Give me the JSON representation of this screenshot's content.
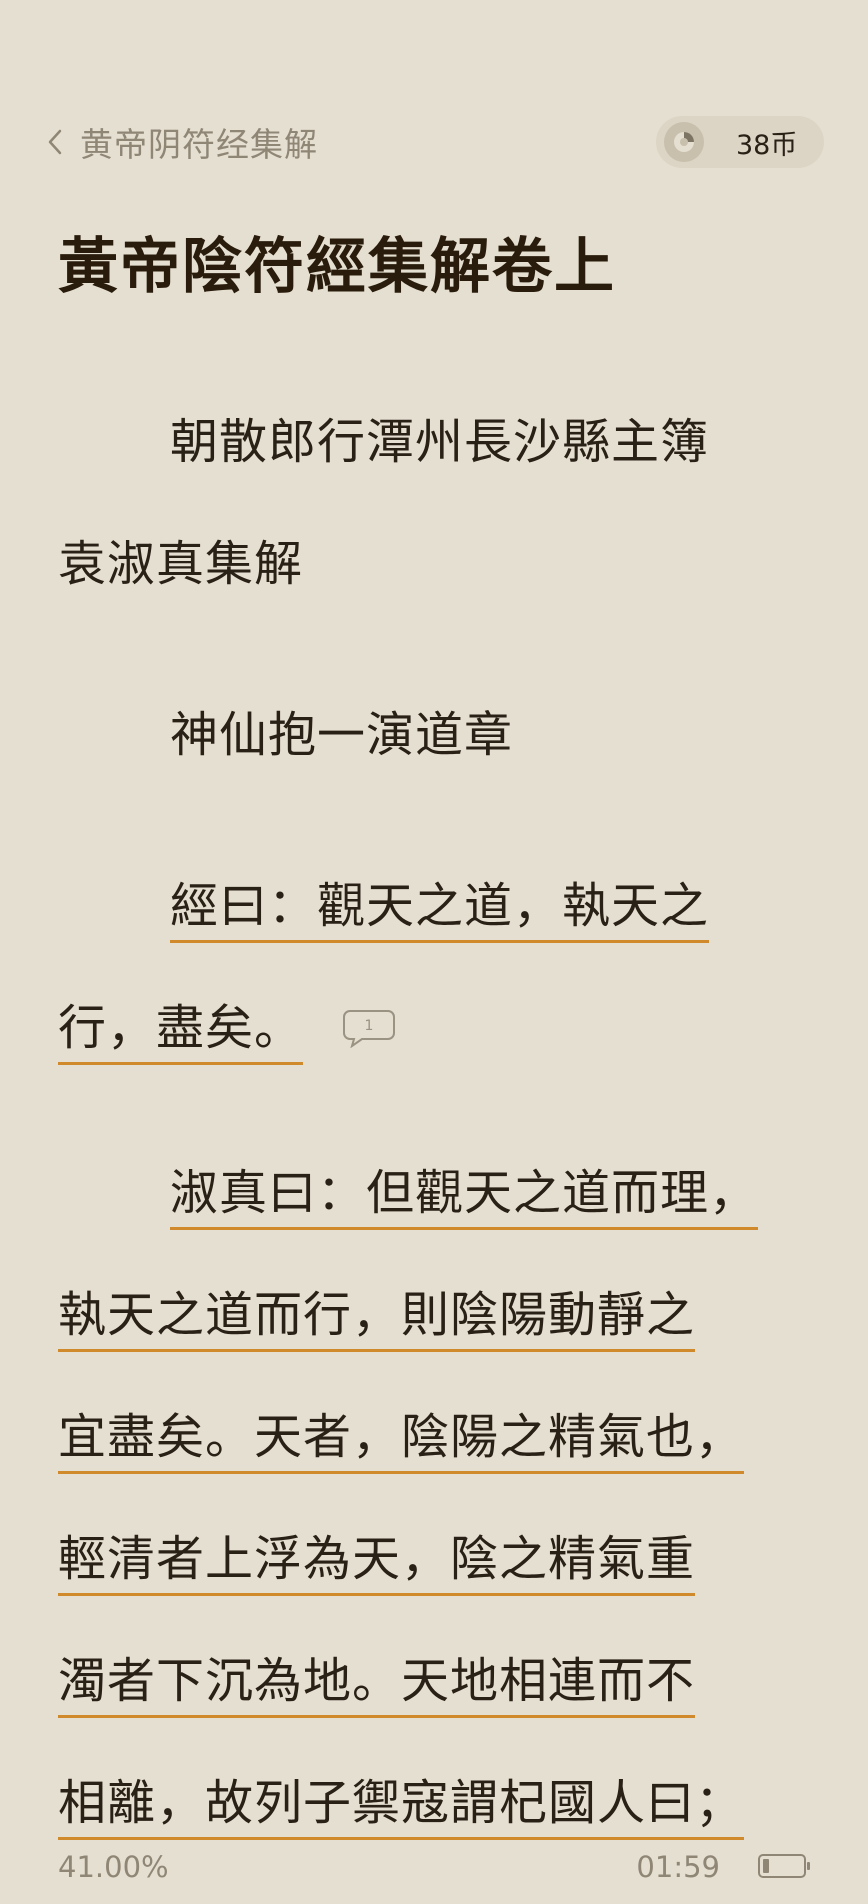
{
  "header": {
    "back_title": "黄帝阴符经集解",
    "coins": "38币"
  },
  "chapter": {
    "title": "黃帝陰符經集解卷上"
  },
  "content": {
    "lines": [
      "朝散郎行潭州長沙縣主簿",
      "袁淑真集解",
      "神仙抱一演道章",
      "經曰：觀天之道，執天之",
      "行，盡矣。",
      "淑真曰：但觀天之道而理，",
      "執天之道而行，則陰陽動靜之",
      "宜盡矣。天者，陰陽之精氣也，",
      "輕清者上浮為天，陰之精氣重",
      "濁者下沉為地。天地相連而不",
      "相離，故列子禦寇謂杞國人曰；"
    ],
    "note_count": "1"
  },
  "footer": {
    "progress": "41.00%",
    "time": "01:59",
    "battery_level": 0.15
  },
  "colors": {
    "background": "#e5dfd1",
    "text": "#2a2116",
    "highlight_underline": "#d08a2c",
    "muted": "#8f8676"
  }
}
